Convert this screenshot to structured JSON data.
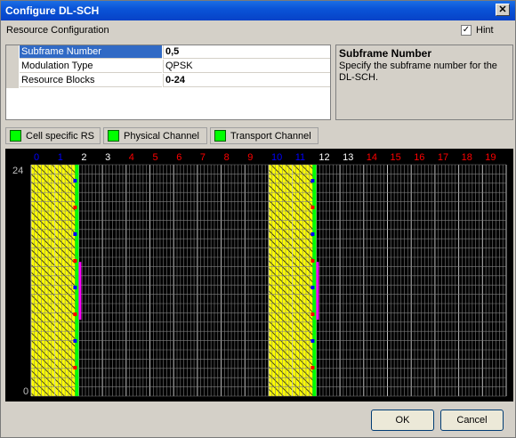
{
  "window": {
    "title": "Configure DL-SCH"
  },
  "section": {
    "label": "Resource Configuration"
  },
  "hint": {
    "label": "Hint",
    "checked": true,
    "glyph": "✓"
  },
  "close": {
    "glyph": "✕"
  },
  "properties": [
    {
      "name": "Subframe Number",
      "value": "0,5"
    },
    {
      "name": "Modulation Type",
      "value": "QPSK"
    },
    {
      "name": "Resource Blocks",
      "value": "0-24"
    }
  ],
  "hint_panel": {
    "title": "Subframe Number",
    "description": "Specify the subframe number for the DL-SCH."
  },
  "legend": [
    {
      "label": "Cell specific RS",
      "color": "#00ff00"
    },
    {
      "label": "Physical Channel",
      "color": "#00ff00"
    },
    {
      "label": "Transport Channel",
      "color": "#00ff00"
    }
  ],
  "grid": {
    "slot_labels": [
      "0",
      "1",
      "2",
      "3",
      "4",
      "5",
      "6",
      "7",
      "8",
      "9",
      "10",
      "11",
      "12",
      "13",
      "14",
      "15",
      "16",
      "17",
      "18",
      "19"
    ],
    "y_labels": [
      "24",
      "0"
    ],
    "label_colors": {
      "blue": "#0000ff",
      "white": "#ffffff",
      "red": "#ff0000"
    },
    "fill_color": "#ffff00",
    "grid_color": "#808080",
    "rs_color": "#00ff00",
    "pbch_color": "#ff00ff"
  },
  "buttons": {
    "ok": "OK",
    "cancel": "Cancel"
  }
}
